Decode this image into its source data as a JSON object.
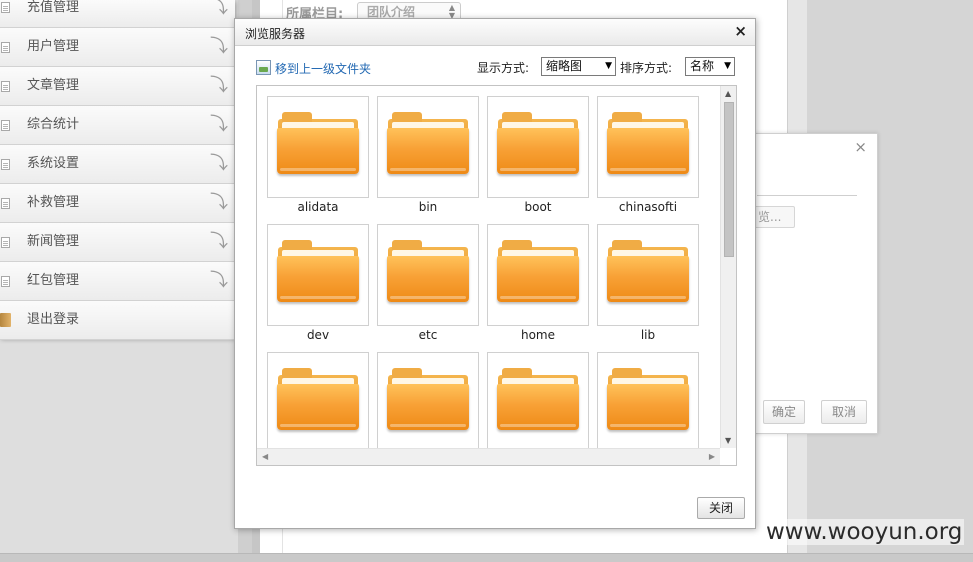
{
  "sidebar": {
    "items": [
      {
        "label": "充值管理",
        "icon": "document-icon"
      },
      {
        "label": "用户管理",
        "icon": "document-icon"
      },
      {
        "label": "文章管理",
        "icon": "document-icon"
      },
      {
        "label": "综合统计",
        "icon": "document-icon"
      },
      {
        "label": "系统设置",
        "icon": "document-icon"
      },
      {
        "label": "补救管理",
        "icon": "document-icon"
      },
      {
        "label": "新闻管理",
        "icon": "document-icon"
      },
      {
        "label": "红包管理",
        "icon": "document-icon"
      },
      {
        "label": "退出登录",
        "icon": "book-icon"
      }
    ]
  },
  "background_form": {
    "field_label": "所属栏目:",
    "field_value": "团队介绍"
  },
  "background_dialog": {
    "browse_label": "览...",
    "ok_label": "确定",
    "cancel_label": "取消"
  },
  "dialog": {
    "title": "浏览服务器",
    "up_link": "移到上一级文件夹",
    "view_label": "显示方式:",
    "view_value": "缩略图",
    "sort_label": "排序方式:",
    "sort_value": "名称",
    "close_button": "关闭",
    "folders": [
      {
        "name": "alidata"
      },
      {
        "name": "bin"
      },
      {
        "name": "boot"
      },
      {
        "name": "chinasofti"
      },
      {
        "name": "dev"
      },
      {
        "name": "etc"
      },
      {
        "name": "home"
      },
      {
        "name": "lib"
      },
      {
        "name": ""
      },
      {
        "name": ""
      },
      {
        "name": ""
      },
      {
        "name": ""
      }
    ]
  },
  "watermark": "www.wooyun.org",
  "colors": {
    "folder": "#f8a136",
    "link": "#2369b3"
  }
}
